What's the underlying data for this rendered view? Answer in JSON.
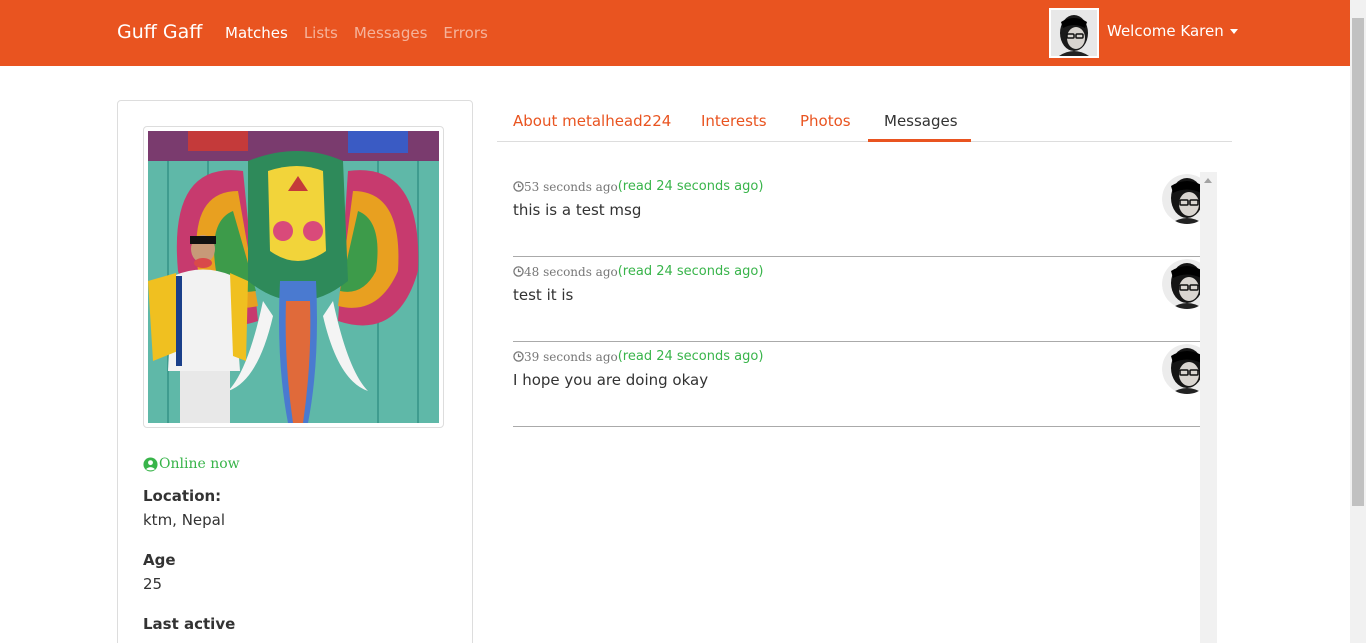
{
  "navbar": {
    "brand": "Guff Gaff",
    "links": [
      "Matches",
      "Lists",
      "Messages",
      "Errors"
    ],
    "welcome": "Welcome Karen",
    "avatar_icon": "user-avatar-icon"
  },
  "colors": {
    "primary": "#e95420",
    "online": "#38b44a",
    "read": "#38b44a"
  },
  "profile": {
    "status": "Online now",
    "location_label": "Location:",
    "location_value": "ktm, Nepal",
    "age_label": "Age",
    "age_value": "25",
    "last_active_label": "Last active"
  },
  "tabs": [
    "About metalhead224",
    "Interests",
    "Photos",
    "Messages"
  ],
  "active_tab": "Messages",
  "messages": [
    {
      "time": "53 seconds ago",
      "read": "(read 24 seconds ago)",
      "text": "this is a test msg"
    },
    {
      "time": "48 seconds ago",
      "read": "(read 24 seconds ago)",
      "text": "test it is"
    },
    {
      "time": "39 seconds ago",
      "read": "(read 24 seconds ago)",
      "text": "I hope you are doing okay"
    }
  ]
}
